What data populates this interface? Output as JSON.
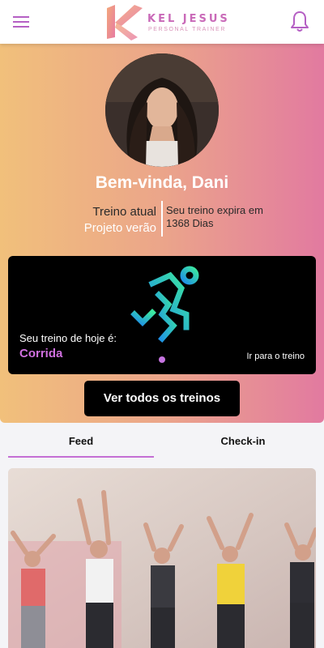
{
  "brand": {
    "name": "KEL JESUS",
    "tagline": "PERSONAL TRAINER"
  },
  "colors": {
    "accent": "#c46fd4",
    "gradient_start": "#f1c07b",
    "gradient_end": "#e27aa0"
  },
  "icons": {
    "menu": "hamburger-icon",
    "notifications": "bell-icon",
    "activity": "running-person-icon"
  },
  "hero": {
    "greeting": "Bem-vinda, Dani",
    "current_training_label": "Treino atual",
    "current_training_value": "Projeto verão",
    "expire_text": "Seu treino expira em 1368 Dias"
  },
  "today": {
    "label": "Seu treino de hoje é:",
    "name": "Corrida",
    "link": "Ir para o treino"
  },
  "actions": {
    "view_all": "Ver todos os treinos"
  },
  "tabs": [
    {
      "label": "Feed",
      "active": true
    },
    {
      "label": "Check-in",
      "active": false
    }
  ]
}
